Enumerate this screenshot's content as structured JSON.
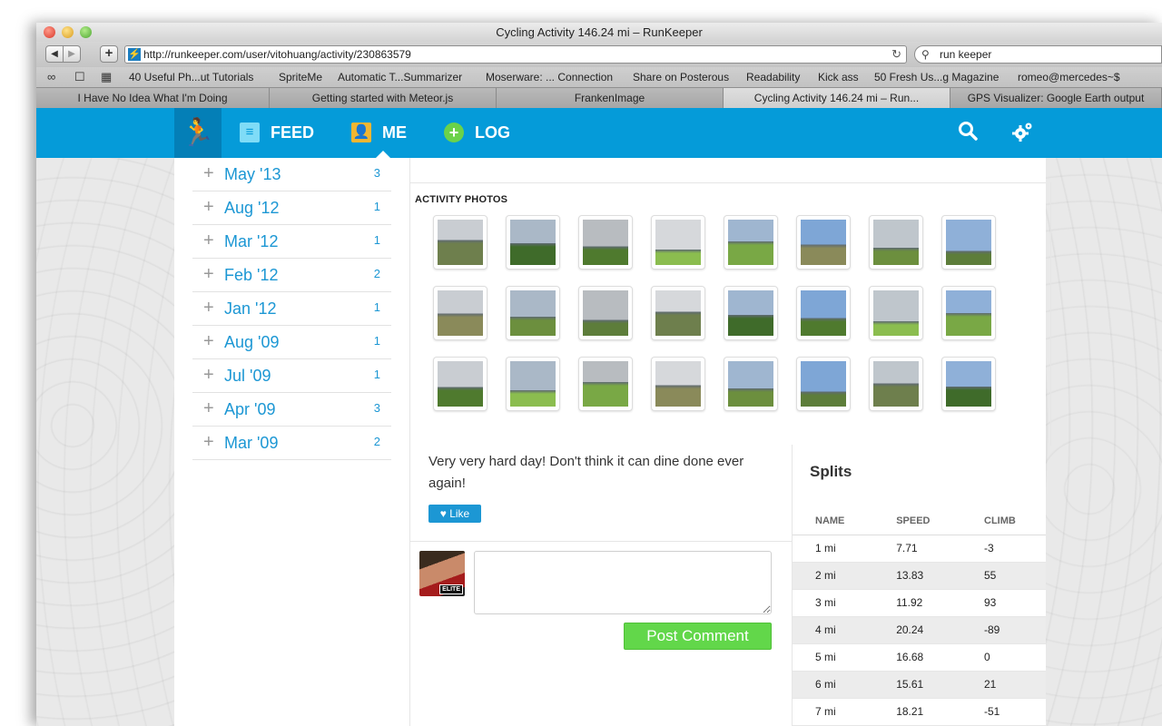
{
  "window": {
    "title": "Cycling Activity 146.24 mi – RunKeeper"
  },
  "toolbar": {
    "back_label": "◀",
    "forward_label": "▶",
    "add_label": "+",
    "url": "http://runkeeper.com/user/vitohuang/activity/230863579",
    "search_value": "run keeper"
  },
  "bookmarks": [
    "40 Useful Ph...ut Tutorials",
    "SpriteMe",
    "Automatic T...Summarizer",
    "Moserware: ... Connection",
    "Share on Posterous",
    "Readability",
    "Kick ass",
    "50 Fresh Us...g Magazine",
    "romeo@mercedes~$"
  ],
  "tabs": [
    {
      "label": "I Have No Idea What I'm Doing"
    },
    {
      "label": "Getting started with Meteor.js"
    },
    {
      "label": "FrankenImage"
    },
    {
      "label": "Cycling Activity 146.24 mi – Run..."
    },
    {
      "label": "GPS Visualizer: Google Earth output"
    }
  ],
  "nav": {
    "feed": "FEED",
    "me": "ME",
    "log": "LOG"
  },
  "sidebar": {
    "months": [
      {
        "label": "May '13",
        "count": "3"
      },
      {
        "label": "Aug '12",
        "count": "1"
      },
      {
        "label": "Mar '12",
        "count": "1"
      },
      {
        "label": "Feb '12",
        "count": "2"
      },
      {
        "label": "Jan '12",
        "count": "1"
      },
      {
        "label": "Aug '09",
        "count": "1"
      },
      {
        "label": "Jul '09",
        "count": "1"
      },
      {
        "label": "Apr '09",
        "count": "3"
      },
      {
        "label": "Mar '09",
        "count": "2"
      }
    ]
  },
  "activity": {
    "photos_title": "ACTIVITY PHOTOS",
    "photo_count": 24,
    "note": "Very very hard day! Don't think it can dine done ever again!",
    "like_label": "Like",
    "post_comment_label": "Post Comment",
    "avatar_badge": "ELITE"
  },
  "splits": {
    "title": "Splits",
    "headers": [
      "NAME",
      "SPEED",
      "CLIMB"
    ],
    "rows": [
      [
        "1 mi",
        "7.71",
        "-3"
      ],
      [
        "2 mi",
        "13.83",
        "55"
      ],
      [
        "3 mi",
        "11.92",
        "93"
      ],
      [
        "4 mi",
        "20.24",
        "-89"
      ],
      [
        "5 mi",
        "16.68",
        "0"
      ],
      [
        "6 mi",
        "15.61",
        "21"
      ],
      [
        "7 mi",
        "18.21",
        "-51"
      ]
    ]
  },
  "colors": {
    "brand": "#059bd9",
    "link": "#1c97d4",
    "post_button": "#62d74a"
  }
}
